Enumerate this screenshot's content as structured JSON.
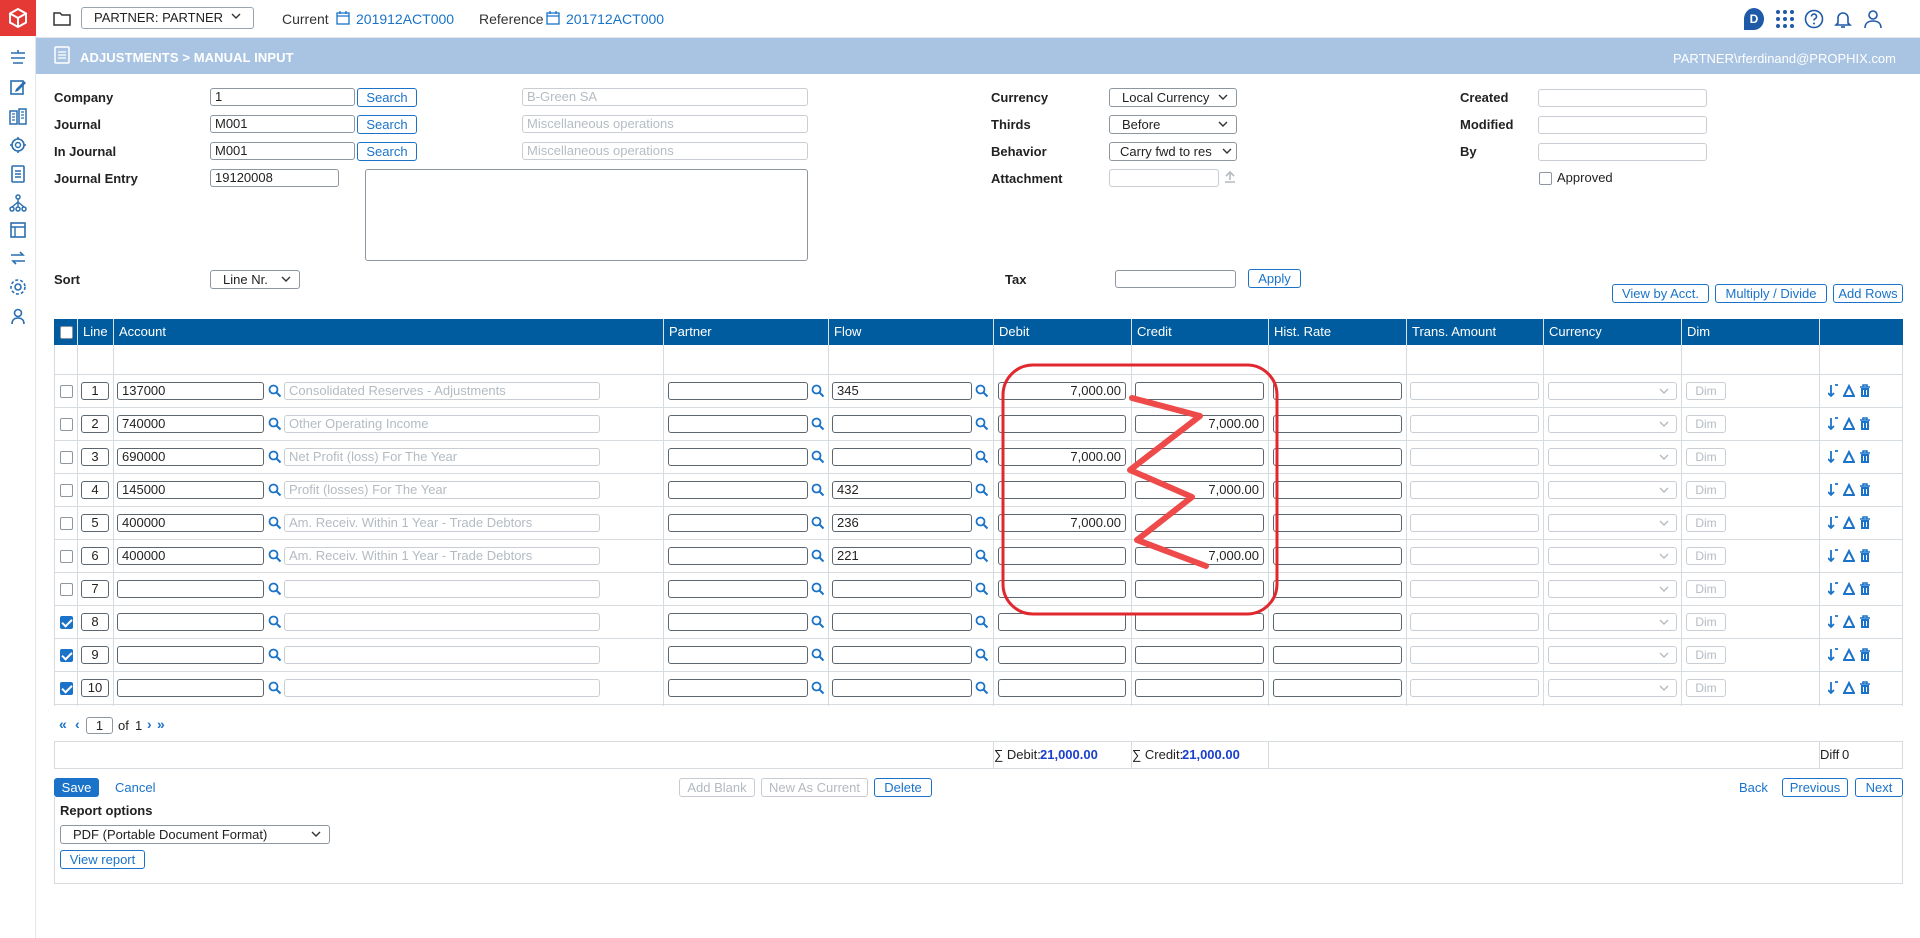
{
  "topbar": {
    "partner_select": "PARTNER: PARTNER",
    "current_label": "Current",
    "current_value": "201912ACT000",
    "reference_label": "Reference",
    "reference_value": "201712ACT000",
    "badge_letter": "D"
  },
  "header": {
    "title": "ADJUSTMENTS > MANUAL INPUT",
    "user": "PARTNER\\rferdinand@PROPHIX.com"
  },
  "form": {
    "company_label": "Company",
    "company_value": "1",
    "company_name": "B-Green SA",
    "journal_label": "Journal",
    "journal_value": "M001",
    "journal_name": "Miscellaneous operations",
    "in_journal_label": "In Journal",
    "in_journal_value": "M001",
    "in_journal_name": "Miscellaneous operations",
    "journal_entry_label": "Journal Entry",
    "journal_entry_value": "19120008",
    "search_label": "Search",
    "currency_label": "Currency",
    "currency_value": "Local Currency",
    "thirds_label": "Thirds",
    "thirds_value": "Before",
    "behavior_label": "Behavior",
    "behavior_value": "Carry fwd to res",
    "attachment_label": "Attachment",
    "created_label": "Created",
    "modified_label": "Modified",
    "by_label": "By",
    "approved_label": "Approved",
    "sort_label": "Sort",
    "sort_value": "Line Nr.",
    "tax_label": "Tax",
    "apply_label": "Apply"
  },
  "grid_actions": {
    "view_by_acct": "View by Acct.",
    "multiply_divide": "Multiply / Divide",
    "add_rows": "Add Rows"
  },
  "columns": {
    "line": "Line",
    "account": "Account",
    "partner": "Partner",
    "flow": "Flow",
    "debit": "Debit",
    "credit": "Credit",
    "hist_rate": "Hist. Rate",
    "trans_amount": "Trans. Amount",
    "currency": "Currency",
    "dim": "Dim"
  },
  "dim_label": "Dim",
  "rows": [
    {
      "line": "1",
      "account": "137000",
      "desc": "Consolidated Reserves - Adjustments",
      "partner": "",
      "flow": "345",
      "debit": "7,000.00",
      "credit": "",
      "checked": false
    },
    {
      "line": "2",
      "account": "740000",
      "desc": "Other Operating Income",
      "partner": "",
      "flow": "",
      "debit": "",
      "credit": "7,000.00",
      "checked": false
    },
    {
      "line": "3",
      "account": "690000",
      "desc": "Net Profit (loss) For The Year",
      "partner": "",
      "flow": "",
      "debit": "7,000.00",
      "credit": "",
      "checked": false
    },
    {
      "line": "4",
      "account": "145000",
      "desc": "Profit (losses) For The Year",
      "partner": "",
      "flow": "432",
      "debit": "",
      "credit": "7,000.00",
      "checked": false
    },
    {
      "line": "5",
      "account": "400000",
      "desc": "Am. Receiv. Within 1 Year - Trade Debtors",
      "partner": "",
      "flow": "236",
      "debit": "7,000.00",
      "credit": "",
      "checked": false
    },
    {
      "line": "6",
      "account": "400000",
      "desc": "Am. Receiv. Within 1 Year - Trade Debtors",
      "partner": "",
      "flow": "221",
      "debit": "",
      "credit": "7,000.00",
      "checked": false
    },
    {
      "line": "7",
      "account": "",
      "desc": "",
      "partner": "",
      "flow": "",
      "debit": "",
      "credit": "",
      "checked": false
    },
    {
      "line": "8",
      "account": "",
      "desc": "",
      "partner": "",
      "flow": "",
      "debit": "",
      "credit": "",
      "checked": true
    },
    {
      "line": "9",
      "account": "",
      "desc": "",
      "partner": "",
      "flow": "",
      "debit": "",
      "credit": "",
      "checked": true
    },
    {
      "line": "10",
      "account": "",
      "desc": "",
      "partner": "",
      "flow": "",
      "debit": "",
      "credit": "",
      "checked": true
    }
  ],
  "pager": {
    "page": "1",
    "of_label": "of",
    "total_pages": "1"
  },
  "totals": {
    "debit_label": "∑ Debit:",
    "debit_value": "21,000.00",
    "credit_label": "∑ Credit:",
    "credit_value": "21,000.00",
    "diff_label": "Diff",
    "diff_value": "0"
  },
  "footer": {
    "save": "Save",
    "cancel": "Cancel",
    "add_blank": "Add Blank",
    "new_as_current": "New As Current",
    "delete": "Delete",
    "back": "Back",
    "previous": "Previous",
    "next": "Next",
    "report_options": "Report options",
    "report_format": "PDF (Portable Document Format)",
    "view_report": "View report"
  },
  "colors": {
    "accent": "#1a73c9",
    "grid_header": "#005c9e",
    "band": "#a9c4e2",
    "annotation": "#e53935"
  }
}
